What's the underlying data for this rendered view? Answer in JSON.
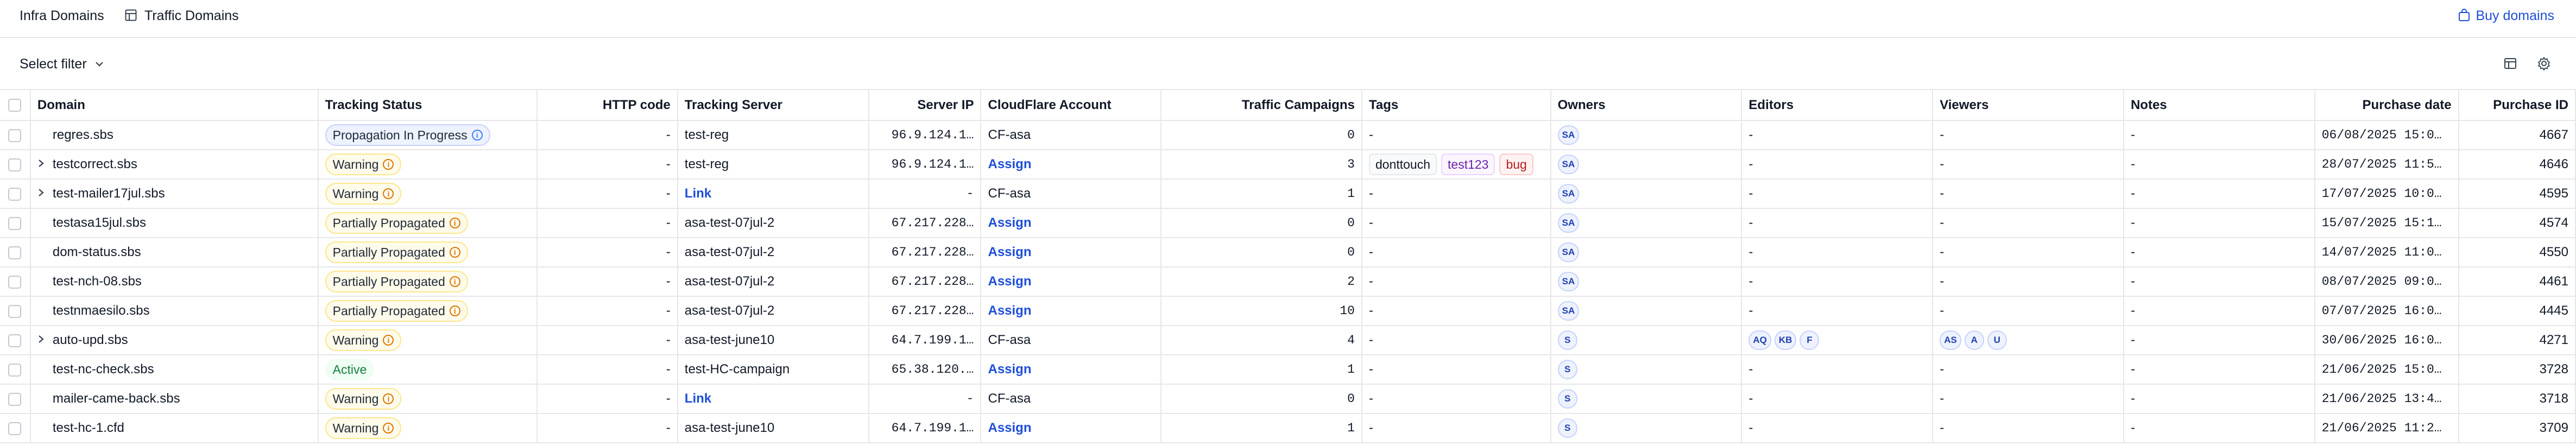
{
  "nav": {
    "tabs": [
      "Infra Domains",
      "Traffic Domains"
    ],
    "buy_label": "Buy domains"
  },
  "filter": {
    "label": "Select filter"
  },
  "colors": {
    "accent": "#1d4ed8",
    "warning_bg": "#fffbeb",
    "active_text": "#15803d"
  },
  "table": {
    "columns": [
      "Domain",
      "Tracking Status",
      "HTTP code",
      "Tracking Server",
      "Server IP",
      "CloudFlare Account",
      "Traffic Campaigns",
      "Tags",
      "Owners",
      "Editors",
      "Viewers",
      "Notes",
      "Purchase date",
      "Purchase ID"
    ],
    "rows": [
      {
        "expand": false,
        "domain": "regres.sbs",
        "status": "Propagation In Progress",
        "status_kind": "blue",
        "http": "-",
        "server": "test-reg",
        "ip": "96.9.124.1…",
        "cf": "CF-asa",
        "cf_link": false,
        "campaigns": "0",
        "tags": [],
        "tags_text": "-",
        "owners": [
          "SA"
        ],
        "editors": [],
        "editors_text": "-",
        "viewers": [],
        "viewers_text": "-",
        "notes": "-",
        "pdate": "06/08/2025 15:0…",
        "pid": "4667"
      },
      {
        "expand": true,
        "domain": "testcorrect.sbs",
        "status": "Warning",
        "status_kind": "amber",
        "http": "-",
        "server": "test-reg",
        "ip": "96.9.124.1…",
        "cf": "Assign",
        "cf_link": true,
        "campaigns": "3",
        "tags": [
          {
            "label": "donttouch",
            "kind": "gray"
          },
          {
            "label": "test123",
            "kind": "purple"
          },
          {
            "label": "bug",
            "kind": "red"
          }
        ],
        "tags_text": "",
        "owners": [
          "SA"
        ],
        "editors": [],
        "editors_text": "-",
        "viewers": [],
        "viewers_text": "-",
        "notes": "-",
        "pdate": "28/07/2025 11:5…",
        "pid": "4646"
      },
      {
        "expand": true,
        "domain": "test-mailer17jul.sbs",
        "status": "Warning",
        "status_kind": "amber",
        "http": "-",
        "server": "Link",
        "server_link": true,
        "ip": "-",
        "cf": "CF-asa",
        "cf_link": false,
        "campaigns": "1",
        "tags": [],
        "tags_text": "-",
        "owners": [
          "SA"
        ],
        "editors": [],
        "editors_text": "-",
        "viewers": [],
        "viewers_text": "-",
        "notes": "-",
        "pdate": "17/07/2025 10:0…",
        "pid": "4595"
      },
      {
        "expand": false,
        "domain": "testasa15jul.sbs",
        "status": "Partially Propagated",
        "status_kind": "amber",
        "http": "-",
        "server": "asa-test-07jul-2",
        "ip": "67.217.228…",
        "cf": "Assign",
        "cf_link": true,
        "campaigns": "0",
        "tags": [],
        "tags_text": "-",
        "owners": [
          "SA"
        ],
        "editors": [],
        "editors_text": "-",
        "viewers": [],
        "viewers_text": "-",
        "notes": "-",
        "pdate": "15/07/2025 15:1…",
        "pid": "4574"
      },
      {
        "expand": false,
        "domain": "dom-status.sbs",
        "status": "Partially Propagated",
        "status_kind": "amber",
        "http": "-",
        "server": "asa-test-07jul-2",
        "ip": "67.217.228…",
        "cf": "Assign",
        "cf_link": true,
        "campaigns": "0",
        "tags": [],
        "tags_text": "-",
        "owners": [
          "SA"
        ],
        "editors": [],
        "editors_text": "-",
        "viewers": [],
        "viewers_text": "-",
        "notes": "-",
        "pdate": "14/07/2025 11:0…",
        "pid": "4550"
      },
      {
        "expand": false,
        "domain": "test-nch-08.sbs",
        "status": "Partially Propagated",
        "status_kind": "amber",
        "http": "-",
        "server": "asa-test-07jul-2",
        "ip": "67.217.228…",
        "cf": "Assign",
        "cf_link": true,
        "campaigns": "2",
        "tags": [],
        "tags_text": "-",
        "owners": [
          "SA"
        ],
        "editors": [],
        "editors_text": "-",
        "viewers": [],
        "viewers_text": "-",
        "notes": "-",
        "pdate": "08/07/2025 09:0…",
        "pid": "4461"
      },
      {
        "expand": false,
        "domain": "testnmaesilo.sbs",
        "status": "Partially Propagated",
        "status_kind": "amber",
        "http": "-",
        "server": "asa-test-07jul-2",
        "ip": "67.217.228…",
        "cf": "Assign",
        "cf_link": true,
        "campaigns": "10",
        "tags": [],
        "tags_text": "-",
        "owners": [
          "SA"
        ],
        "editors": [],
        "editors_text": "-",
        "viewers": [],
        "viewers_text": "-",
        "notes": "-",
        "pdate": "07/07/2025 16:0…",
        "pid": "4445"
      },
      {
        "expand": true,
        "domain": "auto-upd.sbs",
        "status": "Warning",
        "status_kind": "amber",
        "http": "-",
        "server": "asa-test-june10",
        "ip": "64.7.199.1…",
        "cf": "CF-asa",
        "cf_link": false,
        "campaigns": "4",
        "tags": [],
        "tags_text": "-",
        "owners": [
          "S"
        ],
        "editors": [
          "AQ",
          "KB",
          "F"
        ],
        "editors_text": "",
        "viewers": [
          "AS",
          "A",
          "U"
        ],
        "viewers_text": "",
        "notes": "-",
        "pdate": "30/06/2025 16:0…",
        "pid": "4271"
      },
      {
        "expand": false,
        "domain": "test-nc-check.sbs",
        "status": "Active",
        "status_kind": "green",
        "http": "-",
        "server": "test-HC-campaign",
        "ip": "65.38.120.…",
        "cf": "Assign",
        "cf_link": true,
        "campaigns": "1",
        "tags": [],
        "tags_text": "-",
        "owners": [
          "S"
        ],
        "editors": [],
        "editors_text": "-",
        "viewers": [],
        "viewers_text": "-",
        "notes": "-",
        "pdate": "21/06/2025 15:0…",
        "pid": "3728"
      },
      {
        "expand": false,
        "domain": "mailer-came-back.sbs",
        "status": "Warning",
        "status_kind": "amber",
        "http": "-",
        "server": "Link",
        "server_link": true,
        "ip": "-",
        "cf": "CF-asa",
        "cf_link": false,
        "campaigns": "0",
        "tags": [],
        "tags_text": "-",
        "owners": [
          "S"
        ],
        "editors": [],
        "editors_text": "-",
        "viewers": [],
        "viewers_text": "-",
        "notes": "-",
        "pdate": "21/06/2025 13:4…",
        "pid": "3718"
      },
      {
        "expand": false,
        "domain": "test-hc-1.cfd",
        "status": "Warning",
        "status_kind": "amber",
        "http": "-",
        "server": "asa-test-june10",
        "ip": "64.7.199.1…",
        "cf": "Assign",
        "cf_link": true,
        "campaigns": "1",
        "tags": [],
        "tags_text": "-",
        "owners": [
          "S"
        ],
        "editors": [],
        "editors_text": "-",
        "viewers": [],
        "viewers_text": "-",
        "notes": "-",
        "pdate": "21/06/2025 11:2…",
        "pid": "3709"
      }
    ]
  }
}
